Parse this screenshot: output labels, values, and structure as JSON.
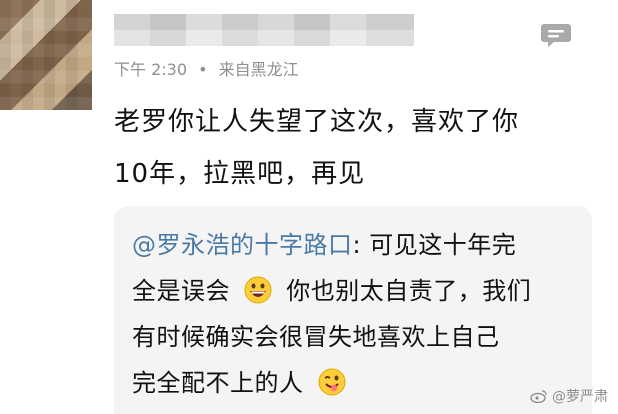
{
  "post": {
    "time": "下午 2:30",
    "source": "来自黑龙江",
    "lines": [
      "老罗你让人失望了这次，喜欢了你",
      "10年，拉黑吧，再见"
    ]
  },
  "quote": {
    "mention": "@罗永浩的十字路口",
    "line1_rest": ": 可见这十年完",
    "line2_a": "全是误会",
    "line2_b": "你也别太自责了，我们",
    "line3": "有时候确实会很冒失地喜欢上自己",
    "line4": "完全配不上的人"
  },
  "watermark": {
    "text": "@萝严肃"
  },
  "icons": {
    "comment": "chat-bubble-icon",
    "emoji_grin": "grinning-emoji-icon",
    "emoji_wink": "winking-tongue-emoji-icon",
    "weibo": "weibo-logo-icon"
  }
}
